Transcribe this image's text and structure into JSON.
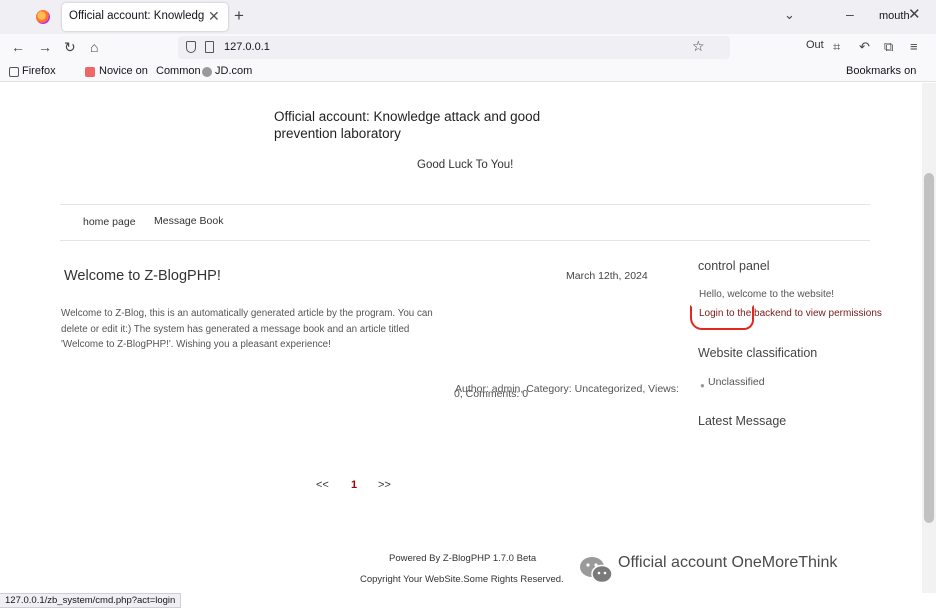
{
  "browser": {
    "tab_title": "Official account: Knowledge attack and good prevention laboratory",
    "tab_close": "✕",
    "new_tab": "+",
    "tab_list": "⌄",
    "minimize": "–",
    "profile_label": "mouth",
    "window_close": "✕",
    "url": "127.0.0.1",
    "out_label": "Out",
    "bookmarks": [
      {
        "label": "Firefox"
      },
      {
        "label": "Novice on"
      },
      {
        "label": "Common"
      },
      {
        "label": "JD.com"
      }
    ],
    "bookmarks_other": "Bookmarks on",
    "status_url": "127.0.0.1/zb_system/cmd.php?act=login"
  },
  "site": {
    "title": "Official account: Knowledge attack and good prevention laboratory",
    "subtitle": "Good Luck To You!",
    "menu": [
      {
        "label": "home page"
      },
      {
        "label": "Message Book"
      }
    ]
  },
  "post": {
    "title": "Welcome to Z-BlogPHP!",
    "date": "March 12th, 2024",
    "body": "Welcome to Z-Blog, this is an automatically generated article by the program. You can delete or edit it:) The system has generated a message book and an article titled 'Welcome to Z-BlogPHP!'. Wishing you a pleasant experience!",
    "meta_line1": "Author: admin, Category: Uncategorized, Views:",
    "meta_line2": "0, Comments: 0"
  },
  "sidebar": {
    "control_panel_title": "control panel",
    "welcome_text": "Hello, welcome to the website!",
    "login_link": "Login to the backend to view permissions",
    "classification_title": "Website classification",
    "category": "Unclassified",
    "latest_message_title": "Latest Message"
  },
  "pager": {
    "prev": "<<",
    "current": "1",
    "next": ">>"
  },
  "footer": {
    "powered_by": "Powered By Z-BlogPHP 1.7.0 Beta",
    "copyright": "Copyright Your WebSite.Some Rights Reserved."
  },
  "watermark": {
    "text": "Official account OneMoreThink"
  },
  "colors": {
    "annotation": "#e0281e",
    "link": "#7a1a1a",
    "pager_current": "#aa0000"
  }
}
